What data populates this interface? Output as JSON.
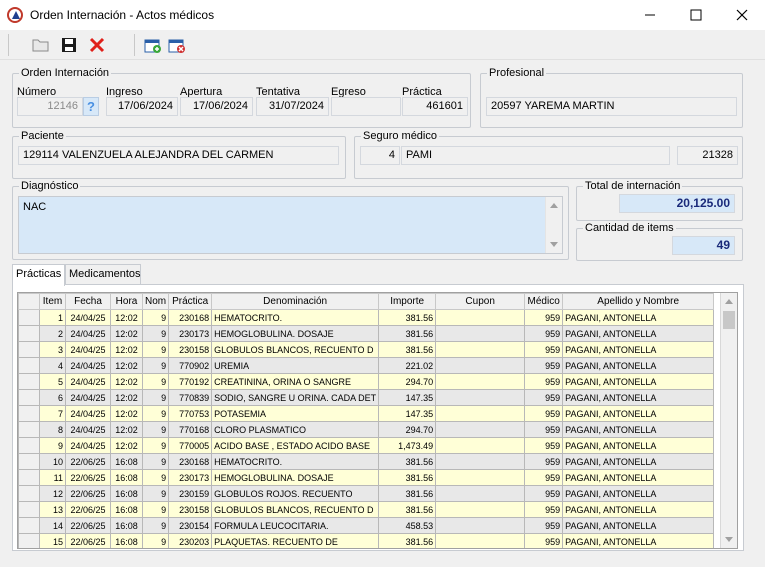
{
  "window": {
    "title": "Orden Internación - Actos médicos"
  },
  "toolbar": {
    "buttons": [
      "open-icon",
      "save-icon",
      "delete-icon",
      "calendar-add-icon",
      "calendar-remove-icon"
    ]
  },
  "orden": {
    "group_label": "Orden Internación",
    "numero_label": "Número",
    "numero": "12146",
    "ingreso_label": "Ingreso",
    "ingreso": "17/06/2024",
    "apertura_label": "Apertura",
    "apertura": "17/06/2024",
    "tentativa_label": "Tentativa",
    "tentativa": "31/07/2024",
    "egreso_label": "Egreso",
    "egreso": "",
    "practica_label": "Práctica",
    "practica": "461601"
  },
  "profesional": {
    "group_label": "Profesional",
    "value": "20597  YAREMA MARTIN"
  },
  "paciente": {
    "group_label": "Paciente",
    "value": "129114  VALENZUELA ALEJANDRA DEL CARMEN"
  },
  "seguro": {
    "group_label": "Seguro médico",
    "codigo": "4",
    "nombre": "PAMI",
    "numero": "21328"
  },
  "diagnostico": {
    "group_label": "Diagnóstico",
    "text": "NAC"
  },
  "totales": {
    "total_label": "Total de internación",
    "total": "20,125.00",
    "cantidad_label": "Cantidad de items",
    "cantidad": "49"
  },
  "tabs": [
    {
      "label": "Prácticas",
      "active": true
    },
    {
      "label": "Medicamentos",
      "active": false
    }
  ],
  "grid": {
    "columns": [
      "Item",
      "Fecha",
      "Hora",
      "Nom",
      "Práctica",
      "Denominación",
      "Importe",
      "Cupon",
      "Médico",
      "Apellido y Nombre"
    ],
    "rows": [
      {
        "item": "1",
        "fecha": "24/04/25",
        "hora": "12:02",
        "nom": "9",
        "practica": "230168",
        "denominacion": "HEMATOCRITO.",
        "importe": "381.56",
        "cupon": "",
        "medico": "959",
        "nombre": "PAGANI, ANTONELLA"
      },
      {
        "item": "2",
        "fecha": "24/04/25",
        "hora": "12:02",
        "nom": "9",
        "practica": "230173",
        "denominacion": "HEMOGLOBULINA. DOSAJE",
        "importe": "381.56",
        "cupon": "",
        "medico": "959",
        "nombre": "PAGANI, ANTONELLA"
      },
      {
        "item": "3",
        "fecha": "24/04/25",
        "hora": "12:02",
        "nom": "9",
        "practica": "230158",
        "denominacion": "GLOBULOS BLANCOS, RECUENTO D",
        "importe": "381.56",
        "cupon": "",
        "medico": "959",
        "nombre": "PAGANI, ANTONELLA"
      },
      {
        "item": "4",
        "fecha": "24/04/25",
        "hora": "12:02",
        "nom": "9",
        "practica": "770902",
        "denominacion": "UREMIA",
        "importe": "221.02",
        "cupon": "",
        "medico": "959",
        "nombre": "PAGANI, ANTONELLA"
      },
      {
        "item": "5",
        "fecha": "24/04/25",
        "hora": "12:02",
        "nom": "9",
        "practica": "770192",
        "denominacion": "CREATININA, ORINA O SANGRE",
        "importe": "294.70",
        "cupon": "",
        "medico": "959",
        "nombre": "PAGANI, ANTONELLA"
      },
      {
        "item": "6",
        "fecha": "24/04/25",
        "hora": "12:02",
        "nom": "9",
        "practica": "770839",
        "denominacion": "SODIO, SANGRE U ORINA. CADA DET",
        "importe": "147.35",
        "cupon": "",
        "medico": "959",
        "nombre": "PAGANI, ANTONELLA"
      },
      {
        "item": "7",
        "fecha": "24/04/25",
        "hora": "12:02",
        "nom": "9",
        "practica": "770753",
        "denominacion": "POTASEMIA",
        "importe": "147.35",
        "cupon": "",
        "medico": "959",
        "nombre": "PAGANI, ANTONELLA"
      },
      {
        "item": "8",
        "fecha": "24/04/25",
        "hora": "12:02",
        "nom": "9",
        "practica": "770168",
        "denominacion": "CLORO PLASMATICO",
        "importe": "294.70",
        "cupon": "",
        "medico": "959",
        "nombre": "PAGANI, ANTONELLA"
      },
      {
        "item": "9",
        "fecha": "24/04/25",
        "hora": "12:02",
        "nom": "9",
        "practica": "770005",
        "denominacion": "ACIDO BASE , ESTADO ACIDO BASE",
        "importe": "1,473.49",
        "cupon": "",
        "medico": "959",
        "nombre": "PAGANI, ANTONELLA"
      },
      {
        "item": "10",
        "fecha": "22/06/25",
        "hora": "16:08",
        "nom": "9",
        "practica": "230168",
        "denominacion": "HEMATOCRITO.",
        "importe": "381.56",
        "cupon": "",
        "medico": "959",
        "nombre": "PAGANI, ANTONELLA"
      },
      {
        "item": "11",
        "fecha": "22/06/25",
        "hora": "16:08",
        "nom": "9",
        "practica": "230173",
        "denominacion": "HEMOGLOBULINA. DOSAJE",
        "importe": "381.56",
        "cupon": "",
        "medico": "959",
        "nombre": "PAGANI, ANTONELLA"
      },
      {
        "item": "12",
        "fecha": "22/06/25",
        "hora": "16:08",
        "nom": "9",
        "practica": "230159",
        "denominacion": "GLOBULOS ROJOS. RECUENTO",
        "importe": "381.56",
        "cupon": "",
        "medico": "959",
        "nombre": "PAGANI, ANTONELLA"
      },
      {
        "item": "13",
        "fecha": "22/06/25",
        "hora": "16:08",
        "nom": "9",
        "practica": "230158",
        "denominacion": "GLOBULOS BLANCOS, RECUENTO D",
        "importe": "381.56",
        "cupon": "",
        "medico": "959",
        "nombre": "PAGANI, ANTONELLA"
      },
      {
        "item": "14",
        "fecha": "22/06/25",
        "hora": "16:08",
        "nom": "9",
        "practica": "230154",
        "denominacion": "FORMULA LEUCOCITARIA.",
        "importe": "458.53",
        "cupon": "",
        "medico": "959",
        "nombre": "PAGANI, ANTONELLA"
      },
      {
        "item": "15",
        "fecha": "22/06/25",
        "hora": "16:08",
        "nom": "9",
        "practica": "230203",
        "denominacion": "PLAQUETAS. RECUENTO DE",
        "importe": "381.56",
        "cupon": "",
        "medico": "959",
        "nombre": "PAGANI, ANTONELLA"
      }
    ]
  }
}
